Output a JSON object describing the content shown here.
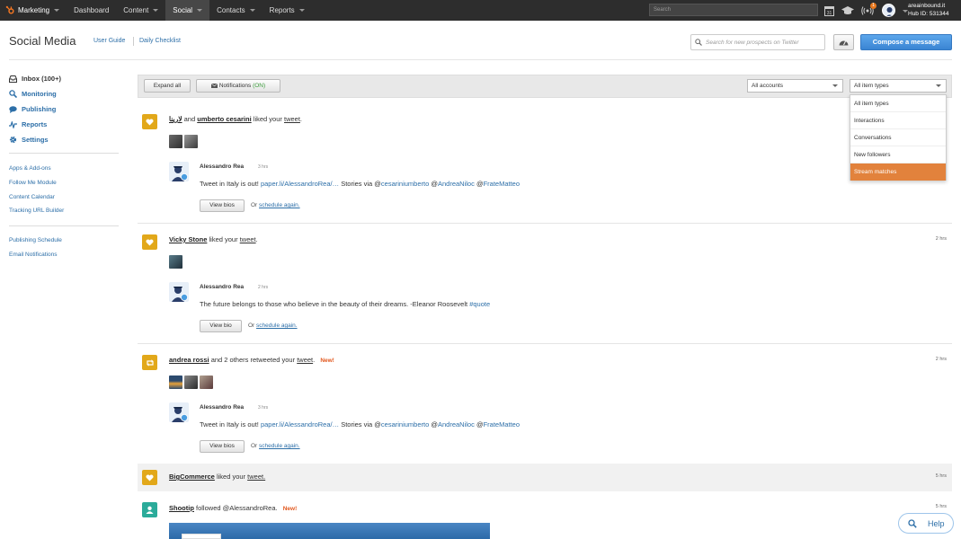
{
  "topnav": {
    "brand": "Marketing",
    "items": [
      "Dashboard",
      "Content",
      "Social",
      "Contacts",
      "Reports"
    ],
    "search_placeholder": "Search",
    "calendar_day": "31",
    "notification_count": "1",
    "account": "areainbound.it",
    "hub_id": "Hub ID: 531344"
  },
  "header": {
    "title": "Social Media",
    "user_guide": "User Guide",
    "daily_checklist": "Daily Checklist",
    "prospect_search_placeholder": "Search for new prospects on Twitter",
    "compose": "Compose a message"
  },
  "sidebar": {
    "primary": [
      {
        "label": "Inbox (100+)",
        "icon": "inbox-icon"
      },
      {
        "label": "Monitoring",
        "icon": "search-icon"
      },
      {
        "label": "Publishing",
        "icon": "chat-bubble-icon"
      },
      {
        "label": "Reports",
        "icon": "pulse-icon"
      },
      {
        "label": "Settings",
        "icon": "gear-icon"
      }
    ],
    "tools": [
      "Apps & Add-ons",
      "Follow Me Module",
      "Content Calendar",
      "Tracking URL Builder"
    ],
    "extra": [
      "Publishing Schedule",
      "Email Notifications"
    ]
  },
  "filterbar": {
    "expand_all": "Expand all",
    "notifications_label": "Notifications",
    "notifications_state": "(ON)",
    "accounts_select": "All accounts",
    "types_select": "All item types"
  },
  "type_dropdown": {
    "options": [
      "All item types",
      "Interactions",
      "Conversations",
      "New followers",
      "Stream matches"
    ],
    "highlighted": 4
  },
  "feed": [
    {
      "type": "like",
      "actor1": "لارينا",
      "connector": "and",
      "actor2": "umberto cesarini",
      "action": "liked your",
      "object": "tweet",
      "timestamp": "",
      "tweet": {
        "author": "Alessandro Rea",
        "time": "3 hrs",
        "text_pre": "Tweet in Italy is out!",
        "link": "paper.li/AlessandroRea/…",
        "text_mid": "Stories via @",
        "mention1": "cesariniumberto",
        "mention2_pre": "@",
        "mention2": "AndreaNiloc",
        "mention3_pre": "@",
        "mention3": "FrateMatteo",
        "view_label": "View bios",
        "or_label": "Or",
        "schedule_label": "schedule again."
      }
    },
    {
      "type": "like",
      "actor1": "Vicky Stone",
      "action": "liked your",
      "object": "tweet",
      "timestamp": "2 hrs",
      "tweet": {
        "author": "Alessandro Rea",
        "time": "2 hrs",
        "text_pre": "The future belongs to those who believe in the beauty of their dreams. -Eleanor Roosevelt",
        "hashtag": "#quote",
        "view_label": "View bio",
        "or_label": "Or",
        "schedule_label": "schedule again."
      }
    },
    {
      "type": "retweet",
      "actor1": "andrea rossi",
      "action": "and 2 others retweeted your",
      "object": "tweet",
      "new_label": "New!",
      "timestamp": "2 hrs",
      "tweet": {
        "author": "Alessandro Rea",
        "time": "3 hrs",
        "text_pre": "Tweet in Italy is out!",
        "link": "paper.li/AlessandroRea/…",
        "text_mid": "Stories via @",
        "mention1": "cesariniumberto",
        "mention2_pre": "@",
        "mention2": "AndreaNiloc",
        "mention3_pre": "@",
        "mention3": "FrateMatteo",
        "view_label": "View bios",
        "or_label": "Or",
        "schedule_label": "schedule again."
      }
    },
    {
      "type": "like",
      "actor1": "BigCommerce",
      "action": "liked your",
      "object": "tweet.",
      "timestamp": "5 hrs"
    },
    {
      "type": "follow",
      "actor1": "Shootip",
      "action": "followed @AlessandroRea.",
      "new_label": "New!",
      "timestamp": "5 hrs"
    }
  ],
  "help": "Help",
  "colors": {
    "accent_blue": "#3a85d3",
    "like_yellow": "#e2a81a",
    "follow_teal": "#2bab9a",
    "highlight_orange": "#e2823c"
  }
}
